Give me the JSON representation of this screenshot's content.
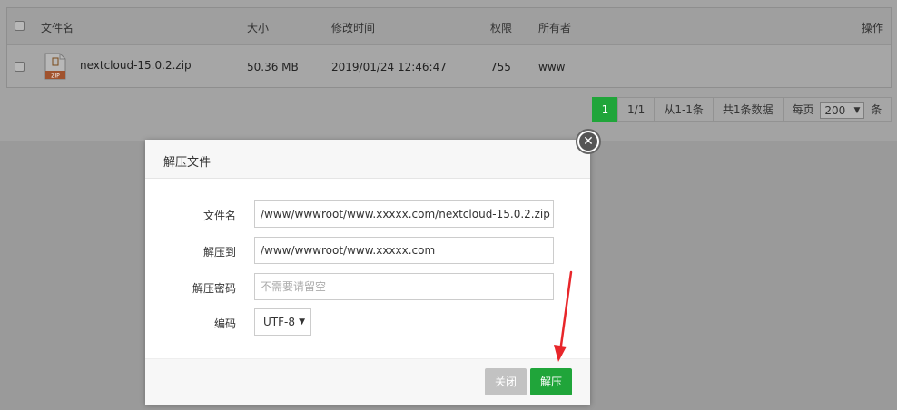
{
  "table": {
    "headers": {
      "name": "文件名",
      "size": "大小",
      "mtime": "修改时间",
      "perm": "权限",
      "owner": "所有者",
      "action": "操作"
    },
    "rows": [
      {
        "icon_label": "ZIP",
        "name": "nextcloud-15.0.2.zip",
        "size": "50.36 MB",
        "mtime": "2019/01/24 12:46:47",
        "perm": "755",
        "owner": "www"
      }
    ]
  },
  "pager": {
    "current": "1",
    "pages": "1/1",
    "range": "从1-1条",
    "total": "共1条数据",
    "per_page_prefix": "每页",
    "per_page_value": "200",
    "per_page_suffix": "条"
  },
  "modal": {
    "title": "解压文件",
    "close_glyph": "✕",
    "fields": {
      "filename_label": "文件名",
      "filename_value": "/www/wwwroot/www.xxxxx.com/nextcloud-15.0.2.zip",
      "dest_label": "解压到",
      "dest_value": "/www/wwwroot/www.xxxxx.com",
      "password_label": "解压密码",
      "password_placeholder": "不需要请留空",
      "encoding_label": "编码",
      "encoding_value": "UTF-8"
    },
    "buttons": {
      "close": "关闭",
      "unzip": "解压"
    }
  },
  "colors": {
    "accent": "#20a53a",
    "annotation_arrow": "#e8262a"
  }
}
